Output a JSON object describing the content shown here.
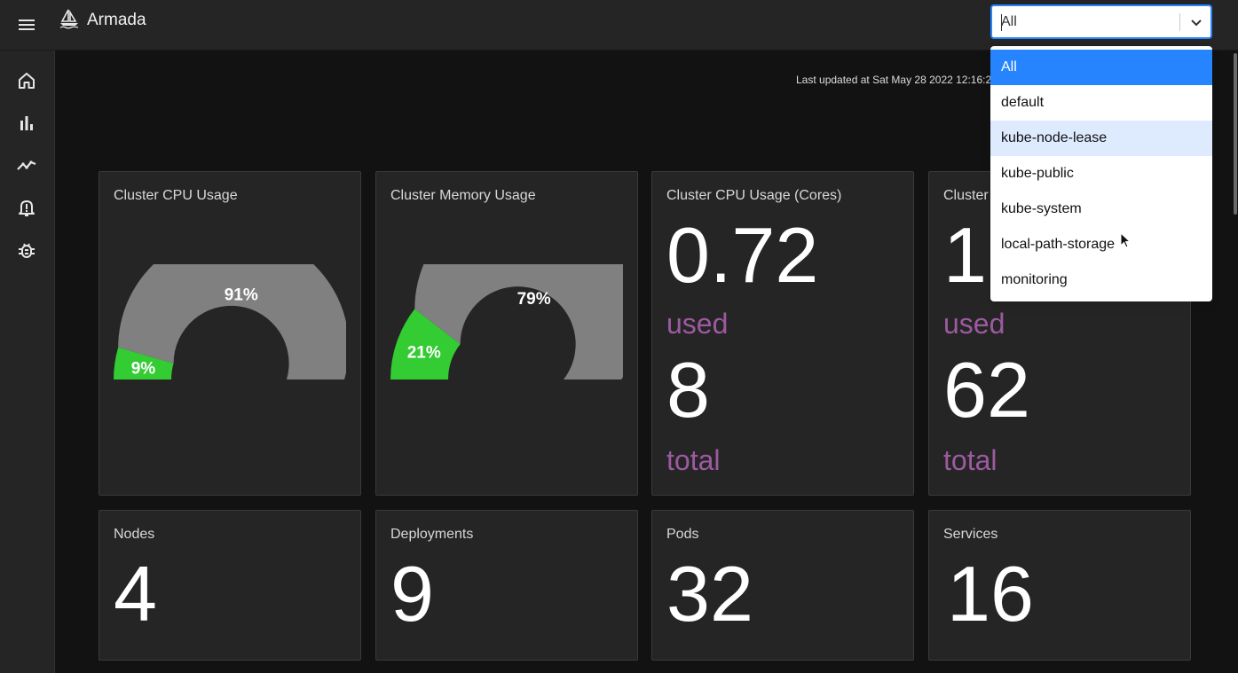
{
  "app": {
    "title": "Armada"
  },
  "header": {
    "last_updated": "Last updated at Sat May 28 2022 12:16:20"
  },
  "namespace_select": {
    "value": "All",
    "options": [
      "All",
      "default",
      "kube-node-lease",
      "kube-public",
      "kube-system",
      "local-path-storage",
      "monitoring"
    ],
    "selected_index": 0,
    "focused_index": 2
  },
  "cards": {
    "cpu_usage": {
      "title": "Cluster CPU Usage",
      "used_label": "9%",
      "free_label": "91%",
      "used_fraction": 0.09
    },
    "memory_usage": {
      "title": "Cluster Memory Usage",
      "used_label": "21%",
      "free_label": "79%",
      "used_fraction": 0.21
    },
    "cpu_cores": {
      "title": "Cluster CPU Usage (Cores)",
      "used": "0.72",
      "used_label": "used",
      "total": "8",
      "total_label": "total"
    },
    "memory_gb": {
      "title": "Cluster",
      "used": "1",
      "used_label": "used",
      "total": "62",
      "total_label": "total"
    },
    "nodes": {
      "title": "Nodes",
      "value": "4"
    },
    "deployments": {
      "title": "Deployments",
      "value": "9"
    },
    "pods": {
      "title": "Pods",
      "value": "32"
    },
    "services": {
      "title": "Services",
      "value": "16"
    }
  },
  "colors": {
    "used": "#33cc33",
    "free": "#808080",
    "accent": "#9c5aa0",
    "select_focus": "#2684ff"
  },
  "icons": {
    "menu": "menu-icon",
    "logo": "sailboat-icon",
    "sidebar": [
      "home-icon",
      "bar-chart-icon",
      "line-chart-icon",
      "alert-bell-icon",
      "bug-icon"
    ]
  }
}
